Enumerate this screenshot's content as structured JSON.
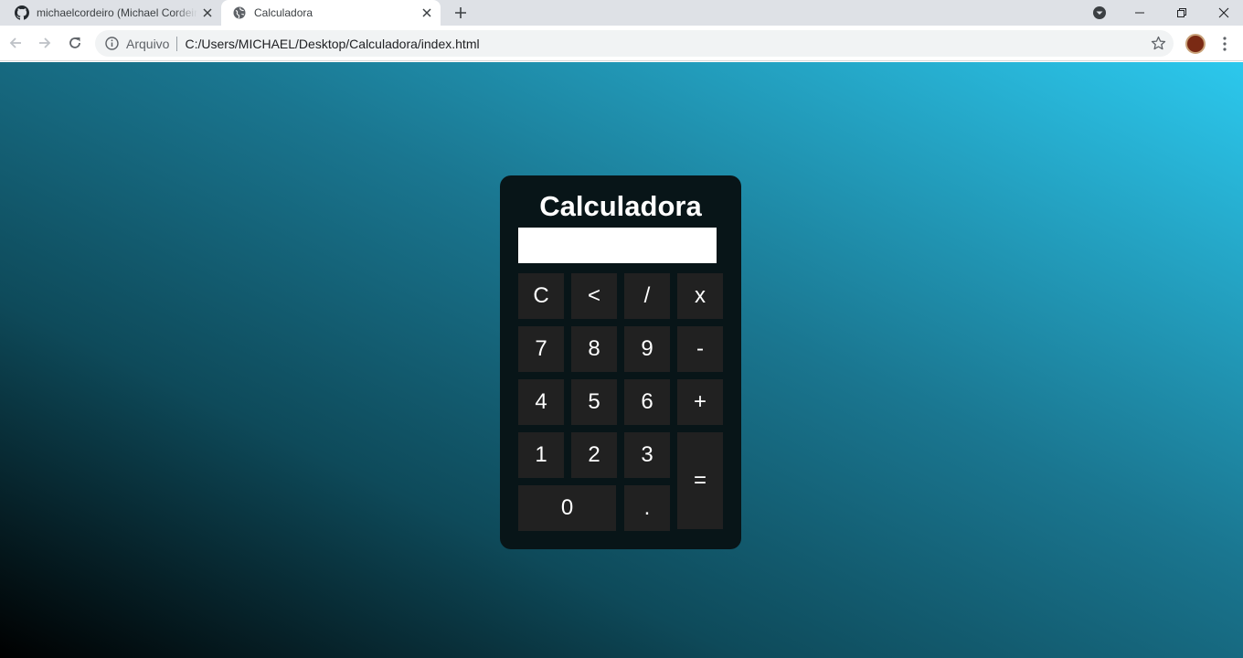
{
  "browser": {
    "tabs": [
      {
        "title": "michaelcordeiro (Michael Cordeiro)",
        "icon": "github-icon",
        "active": false
      },
      {
        "title": "Calculadora",
        "icon": "globe-icon",
        "active": true
      }
    ],
    "address_bar": {
      "scheme_label": "Arquivo",
      "url": "C:/Users/MICHAEL/Desktop/Calculadora/index.html"
    }
  },
  "page": {
    "background_gradient": [
      "#000000",
      "#0e4a5a",
      "#1a7690",
      "#2cc8ed"
    ],
    "calculator": {
      "title": "Calculadora",
      "display_value": "",
      "panel_color": "#081518",
      "key_color": "#212121",
      "keys": {
        "clear": "C",
        "backspace": "<",
        "divide": "/",
        "multiply": "x",
        "seven": "7",
        "eight": "8",
        "nine": "9",
        "minus": "-",
        "four": "4",
        "five": "5",
        "six": "6",
        "plus": "+",
        "one": "1",
        "two": "2",
        "three": "3",
        "equals": "=",
        "zero": "0",
        "decimal": "."
      }
    }
  }
}
